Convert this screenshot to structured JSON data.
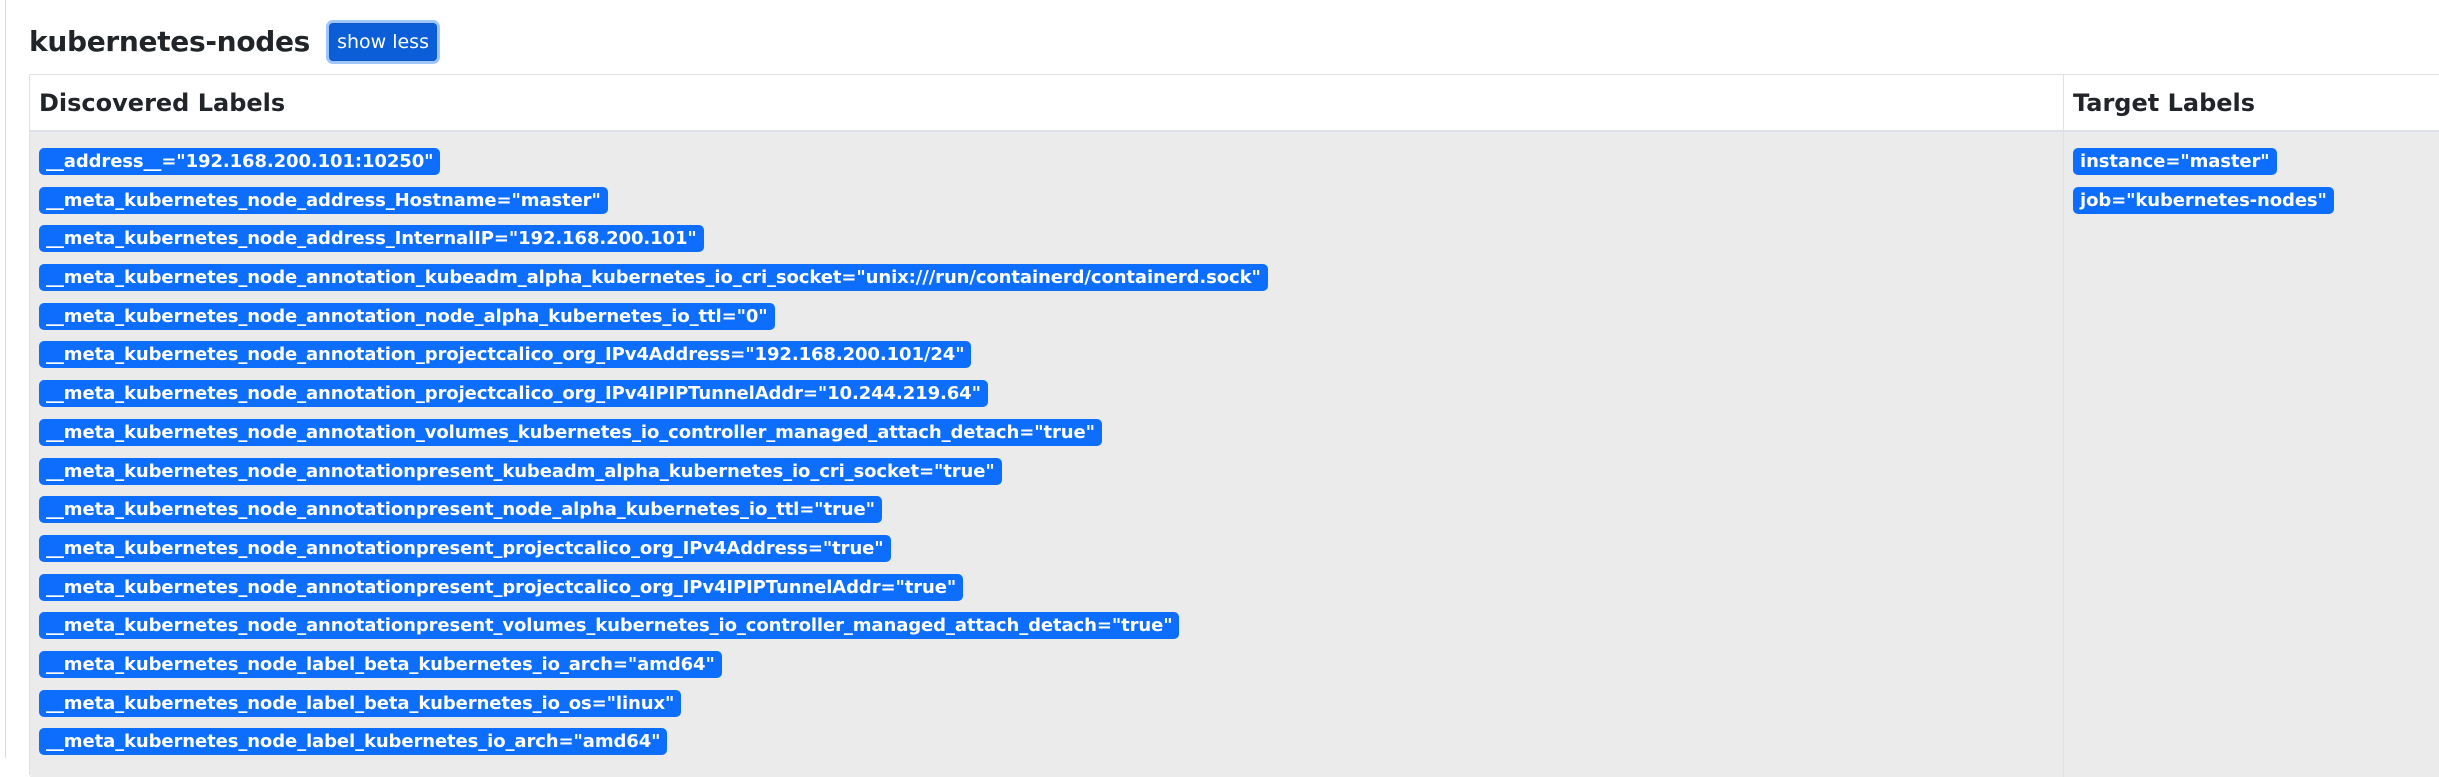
{
  "header": {
    "title": "kubernetes-nodes",
    "toggle_label": "show less"
  },
  "table": {
    "headers": {
      "discovered": "Discovered Labels",
      "target": "Target Labels"
    },
    "discovered_labels": [
      "__address__=\"192.168.200.101:10250\"",
      "__meta_kubernetes_node_address_Hostname=\"master\"",
      "__meta_kubernetes_node_address_InternalIP=\"192.168.200.101\"",
      "__meta_kubernetes_node_annotation_kubeadm_alpha_kubernetes_io_cri_socket=\"unix:///run/containerd/containerd.sock\"",
      "__meta_kubernetes_node_annotation_node_alpha_kubernetes_io_ttl=\"0\"",
      "__meta_kubernetes_node_annotation_projectcalico_org_IPv4Address=\"192.168.200.101/24\"",
      "__meta_kubernetes_node_annotation_projectcalico_org_IPv4IPIPTunnelAddr=\"10.244.219.64\"",
      "__meta_kubernetes_node_annotation_volumes_kubernetes_io_controller_managed_attach_detach=\"true\"",
      "__meta_kubernetes_node_annotationpresent_kubeadm_alpha_kubernetes_io_cri_socket=\"true\"",
      "__meta_kubernetes_node_annotationpresent_node_alpha_kubernetes_io_ttl=\"true\"",
      "__meta_kubernetes_node_annotationpresent_projectcalico_org_IPv4Address=\"true\"",
      "__meta_kubernetes_node_annotationpresent_projectcalico_org_IPv4IPIPTunnelAddr=\"true\"",
      "__meta_kubernetes_node_annotationpresent_volumes_kubernetes_io_controller_managed_attach_detach=\"true\"",
      "__meta_kubernetes_node_label_beta_kubernetes_io_arch=\"amd64\"",
      "__meta_kubernetes_node_label_beta_kubernetes_io_os=\"linux\"",
      "__meta_kubernetes_node_label_kubernetes_io_arch=\"amd64\""
    ],
    "target_labels": [
      "instance=\"master\"",
      "job=\"kubernetes-nodes\""
    ]
  },
  "colors": {
    "badge": "#0d6efd",
    "button": "#0b5ed7",
    "table_body": "#ebebeb"
  }
}
